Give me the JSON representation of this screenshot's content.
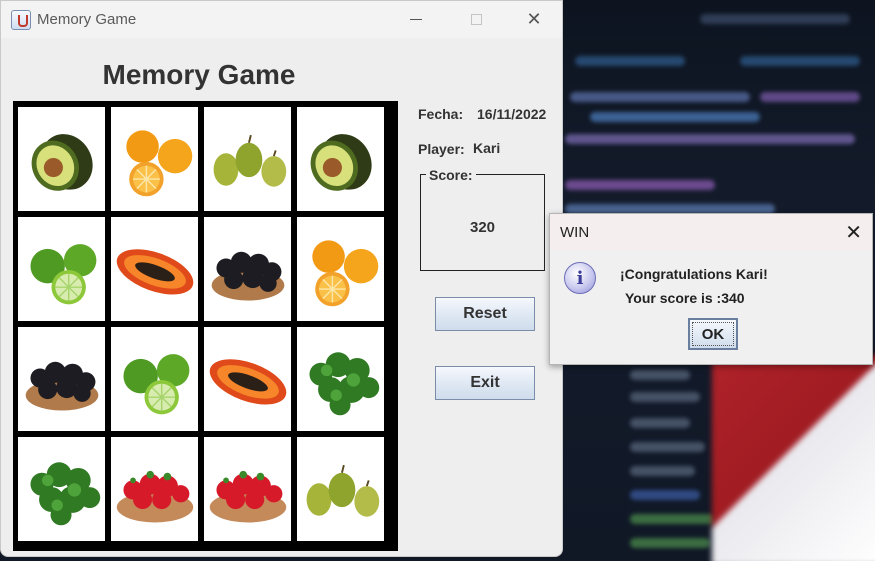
{
  "window": {
    "title": "Memory Game"
  },
  "game": {
    "title": "Memory Game",
    "fecha_label": "Fecha:",
    "fecha_value": "16/11/2022",
    "player_label": "Player:",
    "player_value": "Kari",
    "score_label": "Score:",
    "score_value": "320",
    "reset_label": "Reset",
    "exit_label": "Exit"
  },
  "board": {
    "rows": [
      [
        "avocado",
        "orange",
        "pear",
        "avocado"
      ],
      [
        "lime",
        "papaya",
        "blackberry",
        "orange"
      ],
      [
        "blackberry",
        "lime",
        "papaya",
        "parsley"
      ],
      [
        "parsley",
        "strawberry",
        "strawberry",
        "pear"
      ]
    ]
  },
  "dialog": {
    "title": "WIN",
    "message_line1": "¡Congratulations Kari!",
    "message_line2": "Your score is :340",
    "ok_label": "OK",
    "icon": "info-icon"
  }
}
